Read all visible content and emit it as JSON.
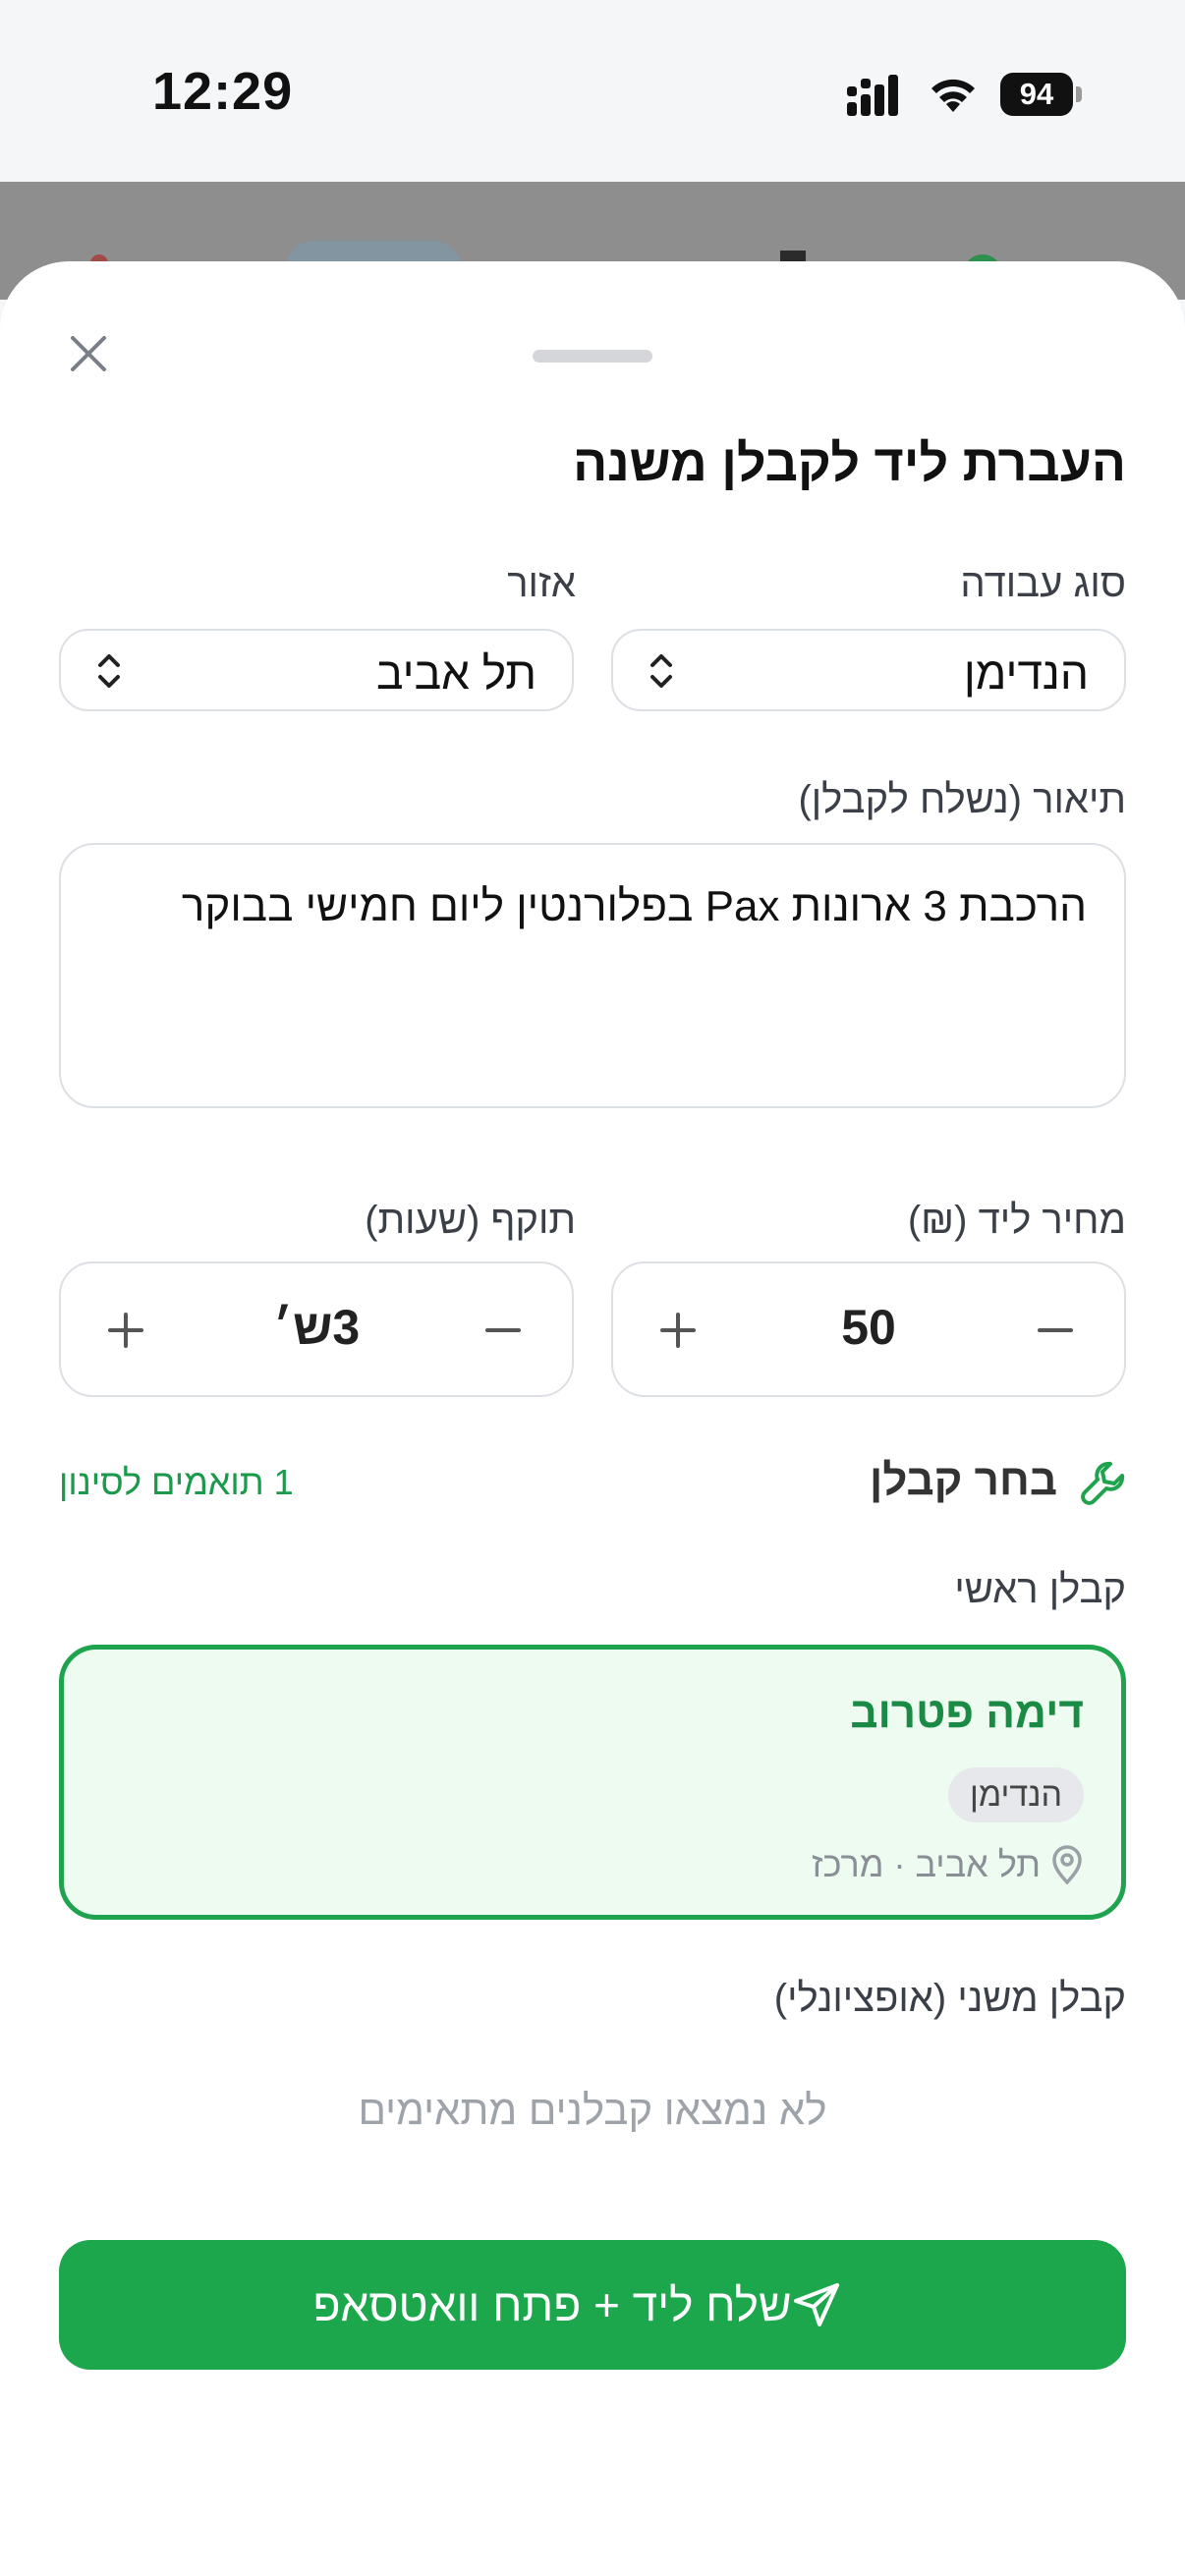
{
  "status_bar": {
    "time": "12:29",
    "battery": "94"
  },
  "sheet": {
    "title": "העברת ליד לקבלן משנה",
    "job_type": {
      "label": "סוג עבודה",
      "value": "הנדימן"
    },
    "area": {
      "label": "אזור",
      "value": "תל אביב"
    },
    "description": {
      "label": "תיאור (נשלח לקבלן)",
      "value": "הרכבת 3 ארונות Pax בפלורנטין ליום חמישי בבוקר"
    },
    "lead_price": {
      "label": "מחיר ליד (₪)",
      "value": "50"
    },
    "validity": {
      "label": "תוקף (שעות)",
      "value": "3ש׳"
    },
    "choose_contractor": {
      "label": "בחר קבלן",
      "matches": "1 תואמים לסינון"
    },
    "main_contractor": {
      "label": "קבלן ראשי",
      "name": "דימה פטרוב",
      "badge": "הנדימן",
      "location": "תל אביב · מרכז"
    },
    "secondary_contractor": {
      "label": "קבלן משני (אופציונלי)",
      "empty": "לא נמצאו קבלנים מתאימים"
    },
    "send_button": "שלח ליד + פתח וואטסאפ"
  },
  "colors": {
    "accent": "#1ca74d",
    "accent_text": "#1b8a44",
    "card_bg": "#edfbf1"
  },
  "icons": [
    "close-icon",
    "chevron-updown-icon",
    "minus-icon",
    "plus-icon",
    "wrench-icon",
    "location-pin-icon",
    "send-icon"
  ]
}
